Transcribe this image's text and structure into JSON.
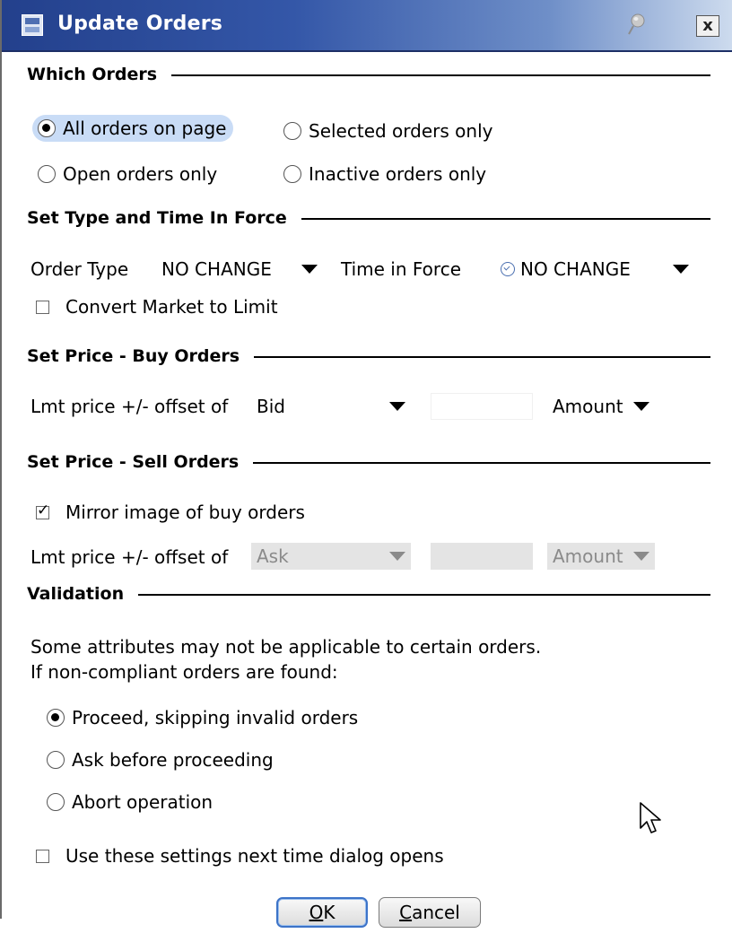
{
  "window": {
    "title": "Update Orders",
    "close_glyph": "x"
  },
  "which_orders": {
    "title": "Which Orders",
    "options": [
      "All orders on page",
      "Selected orders only",
      "Open orders only",
      "Inactive orders only"
    ],
    "selected": "All orders on page"
  },
  "type_tif": {
    "title": "Set Type and Time In Force",
    "order_type_label": "Order Type",
    "order_type_value": "NO CHANGE",
    "tif_label": "Time in Force",
    "tif_value": "NO CHANGE",
    "convert_label": "Convert Market to Limit",
    "convert_checked": false
  },
  "buy": {
    "title": "Set Price - Buy Orders",
    "label": "Lmt price +/- offset of",
    "base_value": "Bid",
    "offset_value": "",
    "unit_value": "Amount"
  },
  "sell": {
    "title": "Set Price - Sell Orders",
    "mirror_label": "Mirror image of buy orders",
    "mirror_checked": true,
    "label": "Lmt price +/- offset of",
    "base_value": "Ask",
    "offset_value": "",
    "unit_value": "Amount"
  },
  "validation": {
    "title": "Validation",
    "line1": "Some attributes may not be applicable to certain orders.",
    "line2": "If non-compliant orders are found:",
    "options": [
      "Proceed, skipping invalid orders",
      "Ask before proceeding",
      "Abort operation"
    ],
    "selected": "Proceed, skipping invalid orders"
  },
  "remember": {
    "label": "Use these settings next time dialog opens",
    "checked": false
  },
  "buttons": {
    "ok_mnemonic": "O",
    "ok_rest": "K",
    "cancel_mnemonic": "C",
    "cancel_rest": "ancel"
  },
  "colors": {
    "titlebar": "#2c4c9c",
    "focus_highlight": "#c9dcf6",
    "default_button_border": "#3c73c8"
  }
}
